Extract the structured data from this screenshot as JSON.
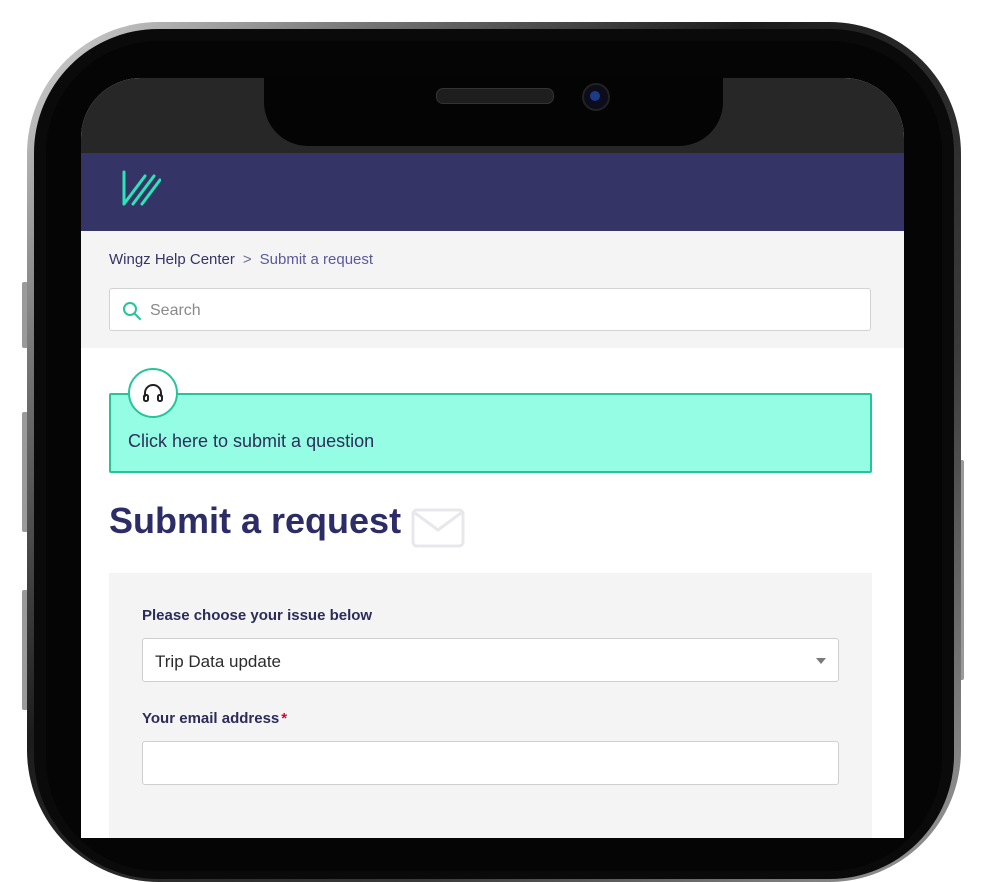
{
  "colors": {
    "header_bg": "#353466",
    "accent": "#27c497",
    "banner_bg": "#94fde4",
    "title_text": "#2c2c66",
    "required": "#e0002b"
  },
  "header": {
    "logo_icon": "wingz-logo"
  },
  "breadcrumb": {
    "home": "Wingz Help Center",
    "separator": ">",
    "current": "Submit a request"
  },
  "search": {
    "placeholder": "Search",
    "icon": "search-icon"
  },
  "banner": {
    "icon": "headset-icon",
    "text": "Click here to submit a question"
  },
  "page": {
    "title": "Submit a request",
    "title_icon": "envelope-icon"
  },
  "form": {
    "issue_label": "Please choose your issue below",
    "issue_value": "Trip Data update",
    "email_label": "Your email address",
    "email_required_mark": "*",
    "email_value": ""
  }
}
